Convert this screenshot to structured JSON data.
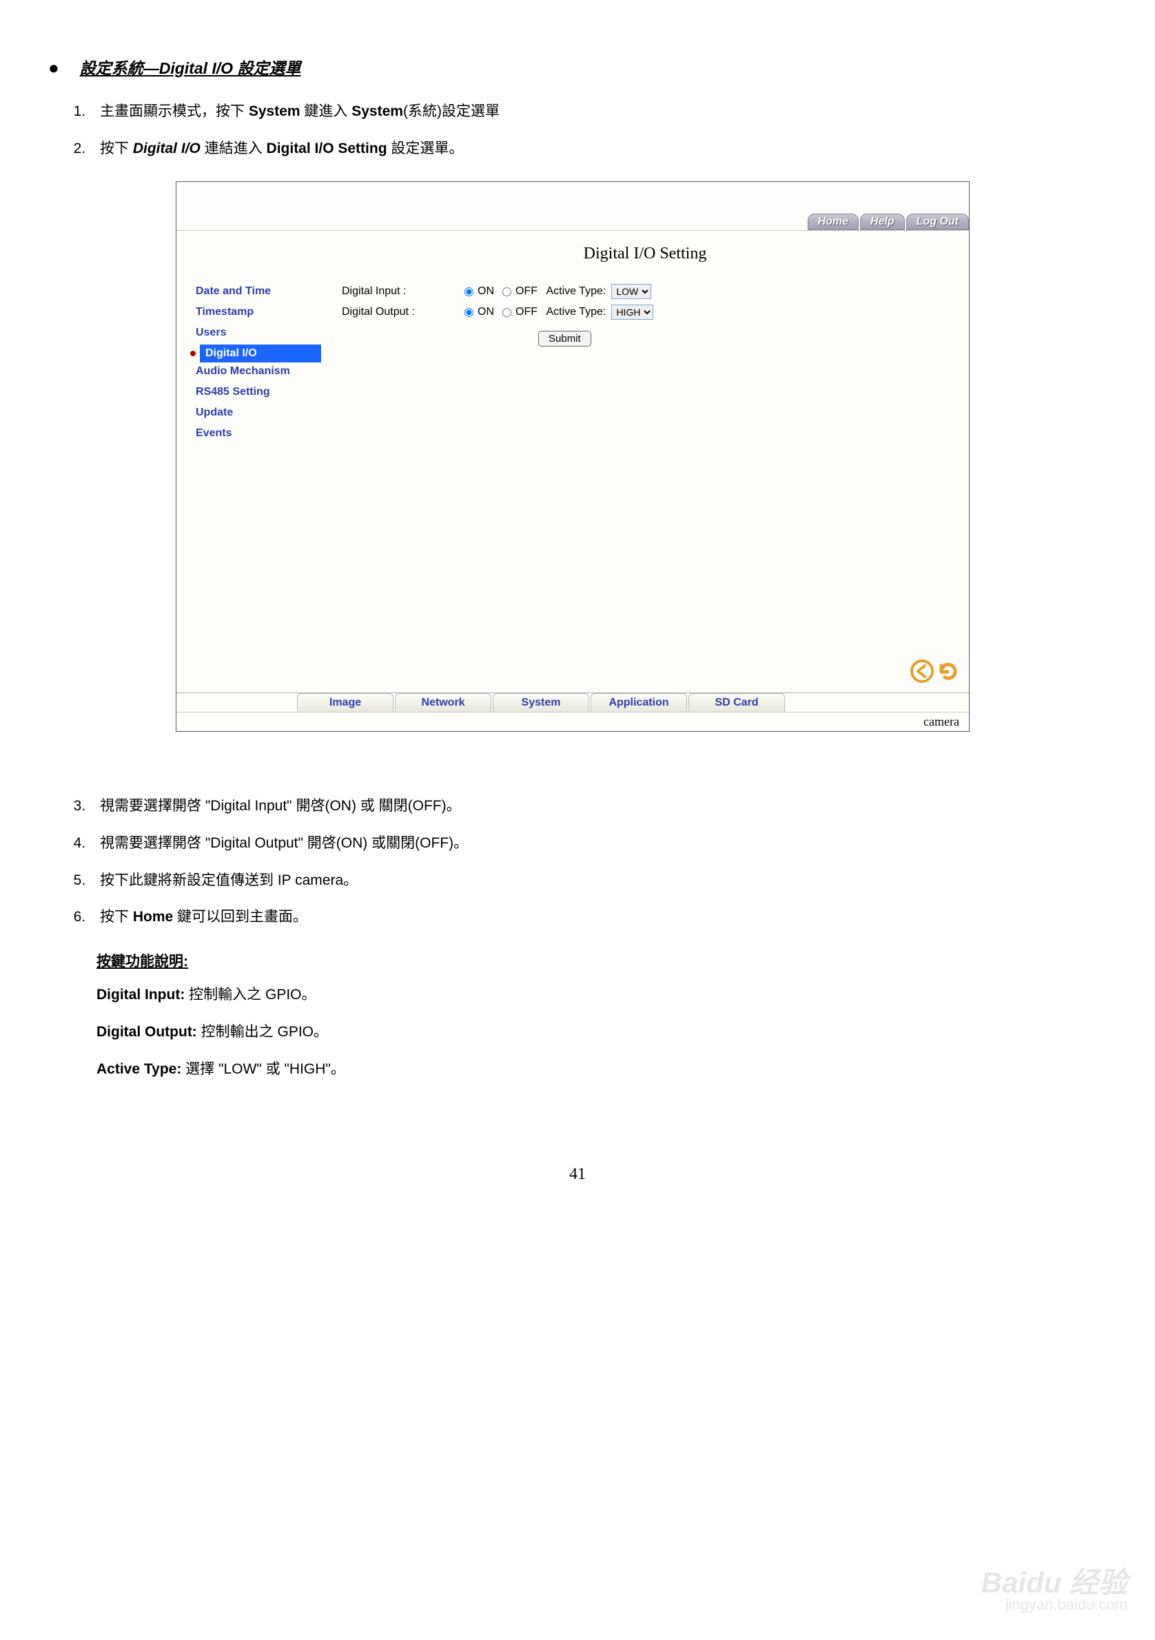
{
  "section_title": "設定系統—Digital I/O 設定選單",
  "steps_top": [
    {
      "pre": "主畫面顯示模式，按下 ",
      "b1": "System",
      "mid": " 鍵進入 ",
      "b2": "System",
      "post": "(系統)設定選單"
    },
    {
      "pre": "按下 ",
      "b1": "Digital I/O",
      "mid": " 連結進入 ",
      "b2": "Digital I/O Setting",
      "post": " 設定選單。"
    }
  ],
  "window": {
    "top_buttons": [
      "Home",
      "Help",
      "Log Out"
    ],
    "title": "Digital I/O Setting",
    "sidebar": [
      "Date and Time",
      "Timestamp",
      "Users",
      "Digital I/O",
      "Audio Mechanism",
      "RS485 Setting",
      "Update",
      "Events"
    ],
    "active_index": 3,
    "form": {
      "input_label": "Digital Input :",
      "output_label": "Digital Output :",
      "on": "ON",
      "off": "OFF",
      "active_type": "Active Type:",
      "input_at_value": "LOW",
      "output_at_value": "HIGH",
      "at_options": [
        "LOW",
        "HIGH"
      ],
      "submit": "Submit"
    },
    "tabs": [
      "Image",
      "Network",
      "System",
      "Application",
      "SD Card"
    ],
    "footer": "camera"
  },
  "steps_bottom": [
    "視需要選擇開啓 \"Digital Input\" 開啓(ON) 或 關閉(OFF)。",
    "視需要選擇開啓 \"Digital Output\" 開啓(ON) 或關閉(OFF)。",
    "按下此鍵將新設定值傳送到 IP camera。",
    {
      "pre": "按下 ",
      "b": "Home",
      "post": " 鍵可以回到主畫面。"
    }
  ],
  "keydesc_title": "按鍵功能說明:",
  "keydesc": [
    {
      "b": "Digital Input:",
      "t": " 控制輸入之 GPIO。"
    },
    {
      "b": "Digital Output:",
      "t": " 控制輸出之 GPIO。"
    },
    {
      "b": "Active Type:",
      "t": " 選擇 \"LOW\" 或 \"HIGH\"。"
    }
  ],
  "page_number": "41",
  "watermark_main": "Baidu 经验",
  "watermark_sub": "jingyan.baidu.com"
}
